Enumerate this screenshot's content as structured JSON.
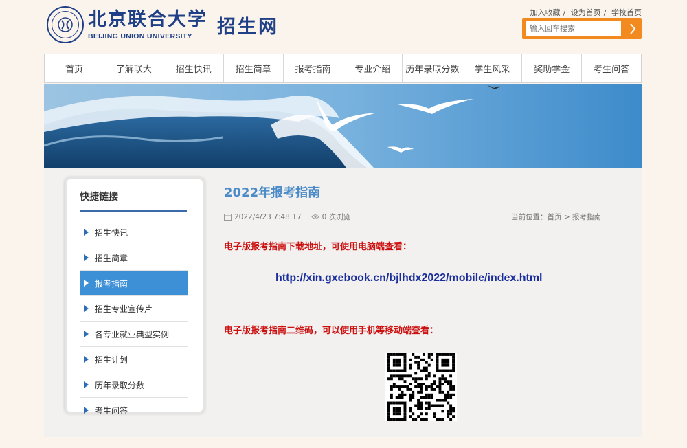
{
  "header": {
    "logo_cn": "北京联合大学",
    "logo_en": "BEIJING UNION UNIVERSITY",
    "site_name": "招生网",
    "top_links": [
      "加入收藏",
      "设为首页",
      "学校首页"
    ],
    "search_placeholder": "输入回车搜索"
  },
  "nav": [
    "首页",
    "了解联大",
    "招生快讯",
    "招生简章",
    "报考指南",
    "专业介绍",
    "历年录取分数",
    "学生风采",
    "奖助学金",
    "考生问答"
  ],
  "sidebar": {
    "title": "快捷链接",
    "items": [
      "招生快讯",
      "招生简章",
      "报考指南",
      "招生专业宣传片",
      "各专业就业典型实例",
      "招生计划",
      "历年录取分数",
      "考生问答"
    ],
    "active_index": 2
  },
  "article": {
    "title": "2022年报考指南",
    "date": "2022/4/23 7:48:17",
    "views": "0 次浏览",
    "breadcrumb": "当前位置：首页 > 报考指南",
    "line1": "电子版报考指南下载地址，可使用电脑端查看：",
    "url": "http://xin.gxebook.cn/bjlhdx2022/mobile/index.html",
    "line2": "电子版报考指南二维码，可以使用手机等移动端查看："
  },
  "colors": {
    "brand_blue": "#1f3f87",
    "accent_orange": "#f28a1f",
    "active_blue": "#3d8fd6",
    "title_blue": "#4a8bc8",
    "notice_red": "#cc1111"
  }
}
